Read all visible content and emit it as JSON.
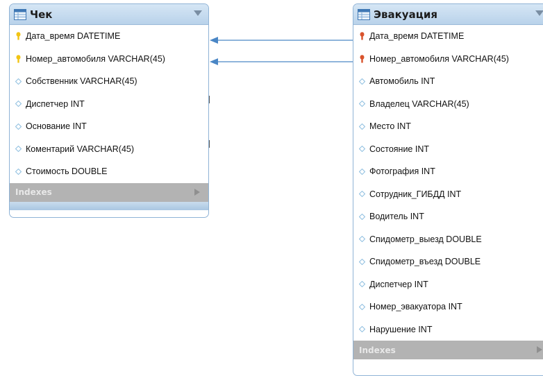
{
  "colors": {
    "header_bg": "#c7dbef",
    "border": "#8fb3d6",
    "indexes_bg": "#b3b3b3",
    "connector": "#4a86c5",
    "pk_key": "#f2c413",
    "fk_key": "#d9532c",
    "attr_diamond": "#8fbfe0"
  },
  "tables": {
    "chek": {
      "title": "Чек",
      "indexes_label": "Indexes",
      "columns": [
        {
          "label": "Дата_время DATETIME",
          "icon": "primary-key-icon"
        },
        {
          "label": "Номер_автомобиля VARCHAR(45)",
          "icon": "primary-key-icon"
        },
        {
          "label": "Собственник VARCHAR(45)",
          "icon": "attribute-diamond-icon"
        },
        {
          "label": "Диспетчер INT",
          "icon": "attribute-diamond-icon"
        },
        {
          "label": "Основание INT",
          "icon": "attribute-diamond-icon"
        },
        {
          "label": "Коментарий VARCHAR(45)",
          "icon": "attribute-diamond-icon"
        },
        {
          "label": "Стоимость DOUBLE",
          "icon": "attribute-diamond-icon"
        }
      ]
    },
    "evakuatsiya": {
      "title": "Эвакуация",
      "indexes_label": "Indexes",
      "columns": [
        {
          "label": "Дата_время DATETIME",
          "icon": "foreign-key-icon"
        },
        {
          "label": "Номер_автомобиля VARCHAR(45)",
          "icon": "foreign-key-icon"
        },
        {
          "label": "Автомобиль INT",
          "icon": "attribute-diamond-icon"
        },
        {
          "label": "Владелец VARCHAR(45)",
          "icon": "attribute-diamond-icon"
        },
        {
          "label": "Место INT",
          "icon": "attribute-diamond-icon"
        },
        {
          "label": "Состояние INT",
          "icon": "attribute-diamond-icon"
        },
        {
          "label": "Фотография INT",
          "icon": "attribute-diamond-icon"
        },
        {
          "label": "Сотрудник_ГИБДД INT",
          "icon": "attribute-diamond-icon"
        },
        {
          "label": "Водитель INT",
          "icon": "attribute-diamond-icon"
        },
        {
          "label": "Спидометр_выезд DOUBLE",
          "icon": "attribute-diamond-icon"
        },
        {
          "label": "Спидометр_въезд DOUBLE",
          "icon": "attribute-diamond-icon"
        },
        {
          "label": "Диспетчер INT",
          "icon": "attribute-diamond-icon"
        },
        {
          "label": "Номер_эвакуатора INT",
          "icon": "attribute-diamond-icon"
        },
        {
          "label": "Нарушение INT",
          "icon": "attribute-diamond-icon"
        }
      ]
    }
  }
}
